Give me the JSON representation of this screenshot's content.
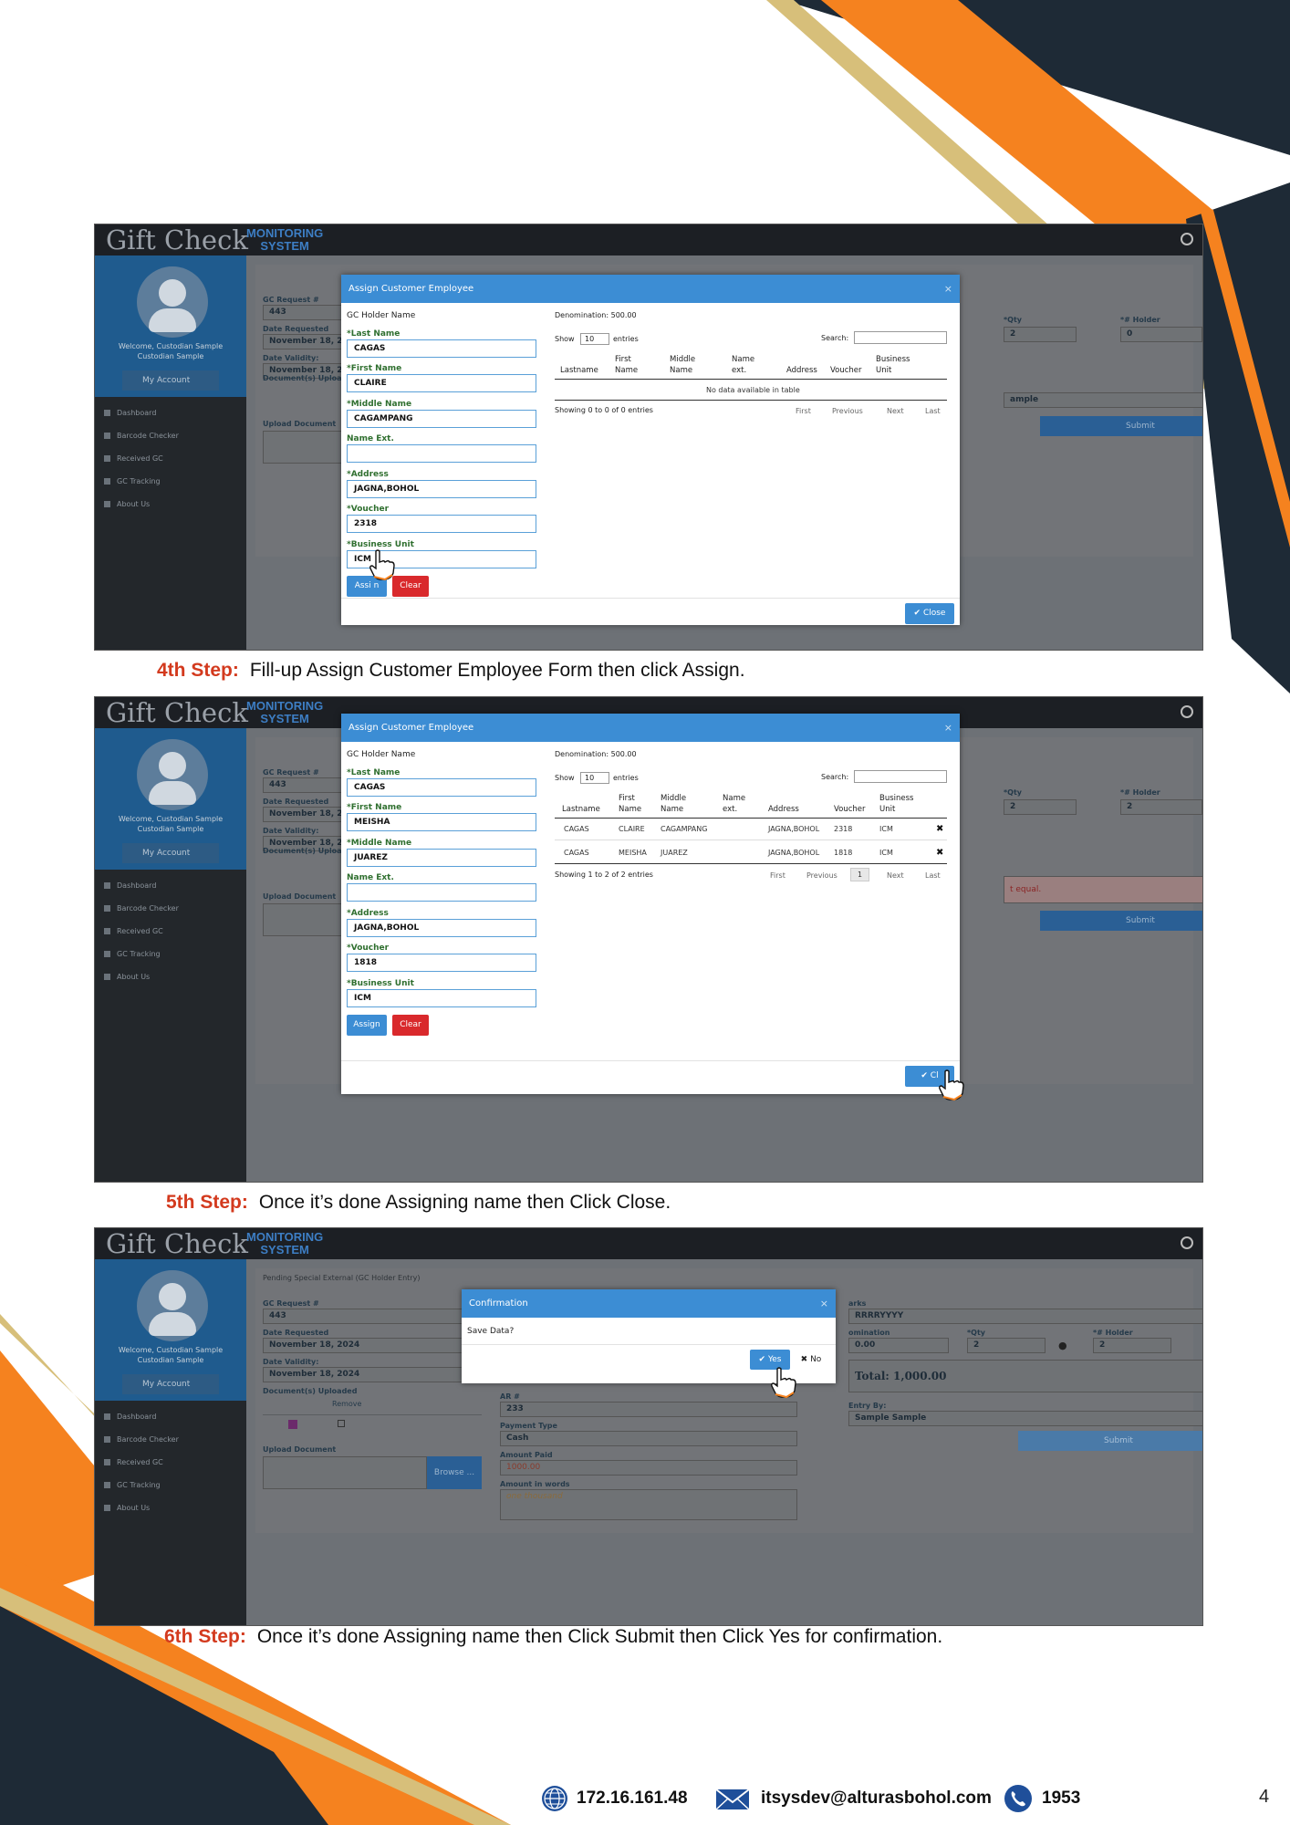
{
  "app": {
    "logo_gift": "Gift",
    "logo_check": "Check",
    "logo_monitoring": "MONITORING",
    "logo_system": "SYSTEM",
    "welcome": "Welcome, Custodian Sample Custodian Sample",
    "my_account": "My Account",
    "nav": [
      "Dashboard",
      "Barcode Checker",
      "Received GC",
      "GC Tracking",
      "About Us"
    ],
    "panel_title": "Pending Special External (GC Holder Entry)",
    "gc_request_label": "GC Request #",
    "gc_request_value": "443",
    "date_requested_label": "Date Requested",
    "date_requested_value": "November 18, 2024",
    "date_validity_label": "Date Validity:",
    "date_validity_value": "November 18, 2024",
    "documents_label": "Document(s) Uploaded",
    "remove_label": "Remove",
    "upload_label": "Upload Document",
    "browse_label": "Browse ...",
    "submit_label": "Submit",
    "qty_label": "*Qty",
    "holder_label": "*# Holder",
    "remarks_label": "arks",
    "denomination_label": "omination",
    "entry_by_label": "Entry By:",
    "entry_by_value": "Sample Sample",
    "entry_by_partial": "ample",
    "not_equal_partial": "t equal.",
    "ar_label": "AR #",
    "ar_value": "233",
    "payment_type_label": "Payment Type",
    "payment_type_value": "Cash",
    "amount_paid_label": "Amount Paid",
    "amount_paid_value": "1000.00",
    "amount_words_label": "Amount in words",
    "amount_words_value": "one thousand",
    "remarks_value": "RRRRYYYY",
    "denom_value": "0.00",
    "qty_value_2": "2",
    "holder_value_1": "0",
    "holder_value_2": "2",
    "total": "Total: 1,000.00"
  },
  "modal": {
    "title": "Assign Customer Employee",
    "close_x": "×",
    "holder_heading": "GC Holder Name",
    "last_name_label": "Last Name",
    "first_name_label": "First Name",
    "middle_name_label": "Middle Name",
    "name_ext_label": "Name Ext.",
    "address_label": "Address",
    "voucher_label": "Voucher",
    "bu_label": "Business Unit",
    "req_mark": "*",
    "assign": "Assign",
    "clear": "Clear",
    "close": "Close",
    "denomination": "Denomination: 500.00",
    "show": "Show",
    "entries_select": "10",
    "entries": "entries",
    "search": "Search:",
    "columns": [
      "Lastname",
      "First Name",
      "Middle Name",
      "Name ext.",
      "Address",
      "Voucher",
      "Business Unit"
    ],
    "col_parts": {
      "first_1": "First",
      "first_2": "Name",
      "middle_1": "Middle",
      "middle_2": "Name",
      "ext_1": "Name",
      "ext_2": "ext.",
      "bu_1": "Business",
      "bu_2": "Unit"
    },
    "pager": [
      "First",
      "Previous",
      "1",
      "Next",
      "Last"
    ]
  },
  "shot1": {
    "last_name": "CAGAS",
    "first_name": "CLAIRE",
    "middle_name": "CAGAMPANG",
    "name_ext": "",
    "address": "JAGNA,BOHOL",
    "voucher": "2318",
    "bu": "ICM",
    "assign_partial": "Assi n",
    "no_data": "No data available in table",
    "showing": "Showing 0 to 0 of 0 entries"
  },
  "shot2": {
    "last_name": "CAGAS",
    "first_name": "MEISHA",
    "middle_name": "JUAREZ",
    "name_ext": "",
    "address": "JAGNA,BOHOL",
    "voucher": "1818",
    "bu": "ICM",
    "rows": [
      {
        "last": "CAGAS",
        "first": "CLAIRE",
        "middle": "CAGAMPANG",
        "ext": "",
        "address": "JAGNA,BOHOL",
        "voucher": "2318",
        "bu": "ICM",
        "del": "✖"
      },
      {
        "last": "CAGAS",
        "first": "MEISHA",
        "middle": "JUAREZ",
        "ext": "",
        "address": "JAGNA,BOHOL",
        "voucher": "1818",
        "bu": "ICM",
        "del": "✖"
      }
    ],
    "showing": "Showing 1 to 2 of 2 entries",
    "close_partial": "Cl"
  },
  "confirm": {
    "title": "Confirmation",
    "message": "Save Data?",
    "yes": "Yes",
    "no": "No"
  },
  "captions": [
    {
      "step": "4th Step:",
      "text": "Fill-up Assign Customer Employee Form then click Assign."
    },
    {
      "step": "5th Step:",
      "text": "Once it’s done Assigning name then Click Close."
    },
    {
      "step": "6th Step:",
      "text": "Once it’s done Assigning name then Click Submit then Click Yes for confirmation."
    }
  ],
  "footer": {
    "ip": "172.16.161.48",
    "email": "itsysdev@alturasbohol.com",
    "phone": "1953",
    "page": "4"
  },
  "colors": {
    "orange": "#f5821f",
    "navy": "#1e2a36",
    "gold": "#d7bf7a",
    "step_red": "#d33a1e",
    "modal_blue": "#3c8dd4"
  }
}
